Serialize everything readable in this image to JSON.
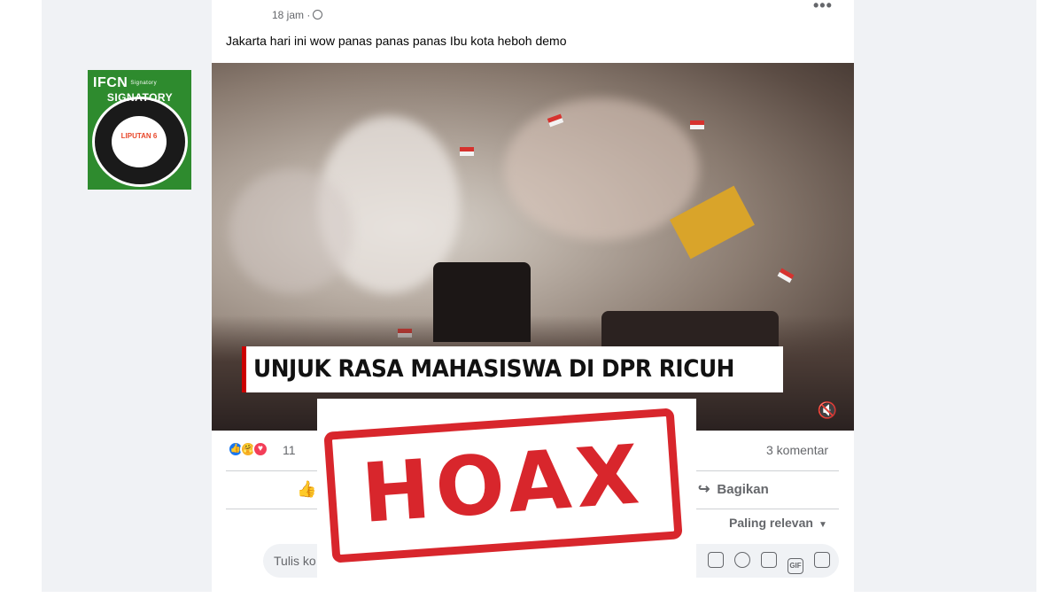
{
  "badge": {
    "brand": "IFCN",
    "brand_sub": "Signatory",
    "ring_text": "SIGNATORY",
    "inner_text": "LIPUTAN 6"
  },
  "post": {
    "time": "18 jam ·",
    "more": "•••",
    "caption": "Jakarta hari ini wow panas panas panas Ibu kota heboh demo"
  },
  "video": {
    "headline": "UNJUK RASA MAHASISWA DI DPR RICUH",
    "mute_symbol": "🔇"
  },
  "stats": {
    "reaction_count": "11",
    "comments": "3 komentar"
  },
  "actions": {
    "like_icon": "thumbs-up-icon",
    "share_label": "Bagikan"
  },
  "sort": {
    "label": "Paling relevan"
  },
  "comment_box": {
    "placeholder": "Tulis ko"
  },
  "overlay": {
    "stamp_text": "HOAX",
    "stamp_color": "#d8262c"
  },
  "colors": {
    "facebook_blue": "#1877f2",
    "background": "#f0f2f5",
    "text_secondary": "#65676b"
  }
}
